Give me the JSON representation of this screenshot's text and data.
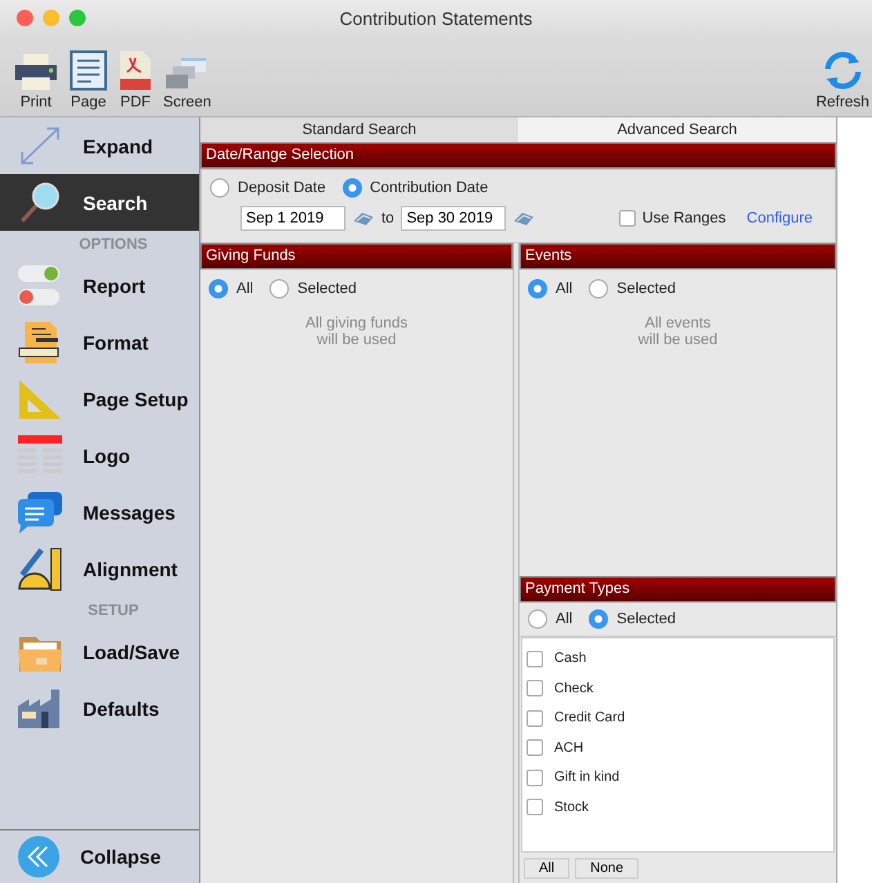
{
  "window": {
    "title": "Contribution Statements"
  },
  "toolbar": {
    "left": [
      {
        "label": "Print"
      },
      {
        "label": "Page"
      },
      {
        "label": "PDF"
      },
      {
        "label": "Screen"
      }
    ],
    "right": [
      {
        "label": "Refresh"
      }
    ]
  },
  "sidebar": {
    "items": [
      {
        "kind": "item",
        "label": "Expand",
        "selected": false
      },
      {
        "kind": "item",
        "label": "Search",
        "selected": true
      },
      {
        "kind": "heading",
        "label": "OPTIONS"
      },
      {
        "kind": "item",
        "label": "Report",
        "selected": false
      },
      {
        "kind": "item",
        "label": "Format",
        "selected": false
      },
      {
        "kind": "item",
        "label": "Page Setup",
        "selected": false
      },
      {
        "kind": "item",
        "label": "Logo",
        "selected": false
      },
      {
        "kind": "item",
        "label": "Messages",
        "selected": false
      },
      {
        "kind": "item",
        "label": "Alignment",
        "selected": false
      },
      {
        "kind": "heading",
        "label": "SETUP"
      },
      {
        "kind": "item",
        "label": "Load/Save",
        "selected": false
      },
      {
        "kind": "item",
        "label": "Defaults",
        "selected": false
      }
    ],
    "collapse": {
      "label": "Collapse"
    }
  },
  "tabs": [
    {
      "label": "Standard Search",
      "selected": true
    },
    {
      "label": "Advanced Search",
      "selected": false
    }
  ],
  "date_range": {
    "title": "Date/Range Selection",
    "options": [
      {
        "label": "Deposit Date",
        "selected": false
      },
      {
        "label": "Contribution Date",
        "selected": true
      }
    ],
    "from": "Sep 1 2019",
    "to_label": "to",
    "to": "Sep 30 2019",
    "use_ranges": {
      "label": "Use Ranges",
      "checked": false
    },
    "configure": "Configure"
  },
  "giving_funds": {
    "title": "Giving Funds",
    "options": [
      {
        "label": "All",
        "selected": true
      },
      {
        "label": "Selected",
        "selected": false
      }
    ],
    "note": [
      "All giving funds",
      "will be used"
    ]
  },
  "events": {
    "title": "Events",
    "options": [
      {
        "label": "All",
        "selected": true
      },
      {
        "label": "Selected",
        "selected": false
      }
    ],
    "note": [
      "All events",
      "will be used"
    ]
  },
  "payment_types": {
    "title": "Payment Types",
    "options": [
      {
        "label": "All",
        "selected": false
      },
      {
        "label": "Selected",
        "selected": true
      }
    ],
    "items": [
      {
        "label": "Cash",
        "checked": false
      },
      {
        "label": "Check",
        "checked": false
      },
      {
        "label": "Credit Card",
        "checked": false
      },
      {
        "label": "ACH",
        "checked": false
      },
      {
        "label": "Gift in kind",
        "checked": false
      },
      {
        "label": "Stock",
        "checked": false
      }
    ],
    "buttons": [
      "All",
      "None"
    ]
  }
}
